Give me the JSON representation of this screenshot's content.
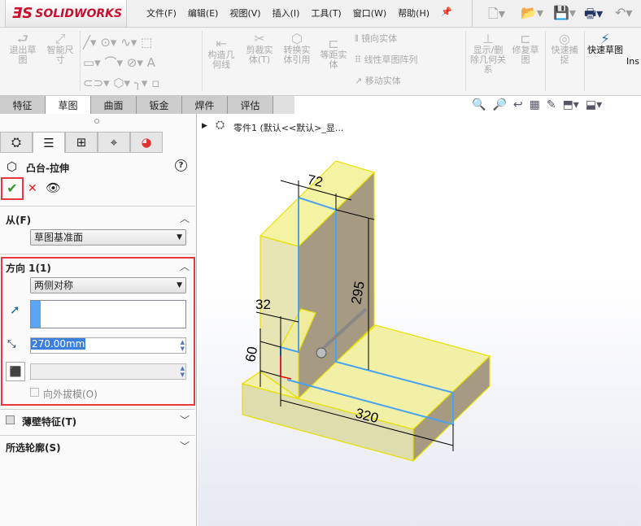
{
  "app": {
    "logo": "SOLIDWORKS",
    "menu": [
      "文件(F)",
      "编辑(E)",
      "视图(V)",
      "插入(I)",
      "工具(T)",
      "窗口(W)",
      "帮助(H)"
    ]
  },
  "ribbon": {
    "exit_sketch": "退出草图",
    "smart_dim": "智能尺寸",
    "construction": "构造几何线",
    "trim": "剪裁实体(T)",
    "convert": "转换实体引用",
    "offset": "等距实体",
    "mirror": "镜向实体",
    "linear_pattern": "线性草图阵列",
    "move": "移动实体",
    "display_delete": "显示/删除几何关系",
    "repair": "修复草图",
    "quick_snap": "快速捕捉",
    "rapid_sketch": "快速草图",
    "ins": "Ins"
  },
  "tabs": [
    "特征",
    "草图",
    "曲面",
    "钣金",
    "焊件",
    "评估"
  ],
  "tree": {
    "item": "零件1  (默认<<默认>_显..."
  },
  "panel": {
    "title": "凸台-拉伸",
    "from_label": "从(F)",
    "from_value": "草图基准面",
    "dir_label": "方向 1(1)",
    "dir_value": "两侧对称",
    "depth": "270.00mm",
    "draft_label": "向外拔模(O)",
    "thin_label": "薄壁特征(T)",
    "contours_label": "所选轮廓(S)"
  },
  "dims": {
    "d72": "72",
    "d295": "295",
    "d32": "32",
    "d60": "60",
    "d320": "320"
  },
  "colors": {
    "accent_red": "#e8383d",
    "sketch_blue": "#4aa3ef",
    "body_yellow": "#f5f3a8"
  }
}
